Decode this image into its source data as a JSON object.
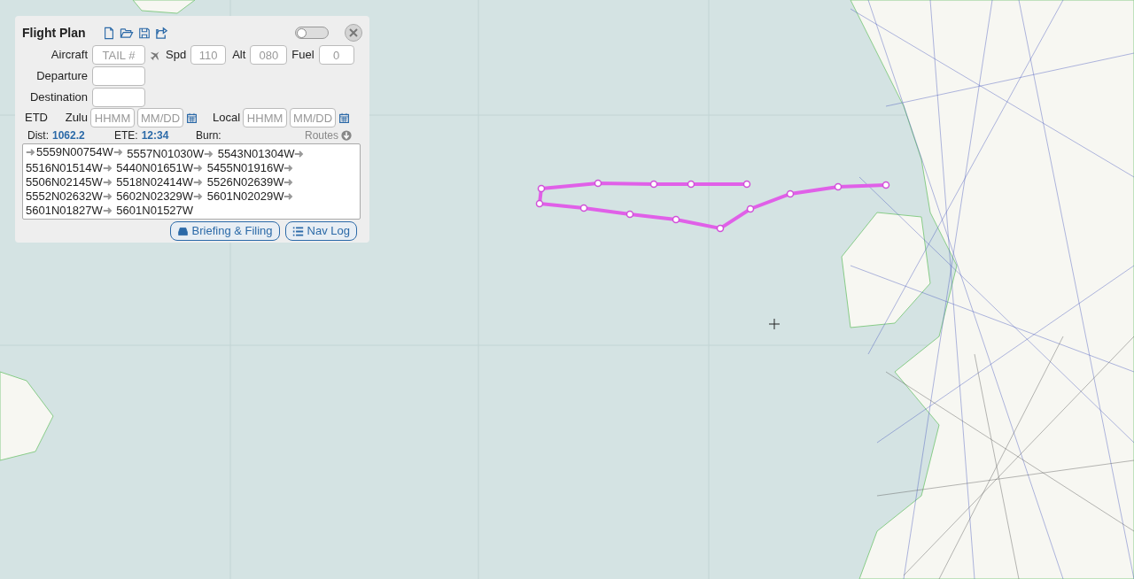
{
  "panel": {
    "title": "Flight Plan",
    "toggle": {
      "on": false
    }
  },
  "aircraft": {
    "label": "Aircraft",
    "placeholder": "TAIL #"
  },
  "speed": {
    "label": "Spd",
    "placeholder": "110"
  },
  "altitude": {
    "label": "Alt",
    "placeholder": "080"
  },
  "fuel": {
    "label": "Fuel",
    "placeholder": "0"
  },
  "departure": {
    "label": "Departure"
  },
  "destination": {
    "label": "Destination"
  },
  "etd": {
    "label": "ETD",
    "zulu": {
      "label": "Zulu",
      "time_placeholder": "HHMM",
      "date_placeholder": "MM/DD"
    },
    "local": {
      "label": "Local",
      "time_placeholder": "HHMM",
      "date_placeholder": "MM/DD"
    }
  },
  "stats": [
    {
      "label": "Dist:",
      "value": "1062.2"
    },
    {
      "label": "ETE:",
      "value": "12:34"
    },
    {
      "label": "Burn:"
    }
  ],
  "routes_link": "Routes",
  "waypoints": [
    "5559N00754W",
    "5557N01030W",
    "5543N01304W",
    "5516N01514W",
    "5440N01651W",
    "5455N01916W",
    "5506N02145W",
    "5518N02414W",
    "5526N02639W",
    "5552N02632W",
    "5602N02329W",
    "5601N02029W",
    "5601N01827W",
    "5601N01527W"
  ],
  "buttons": [
    {
      "kind": "briefing",
      "label": "Briefing & Filing"
    },
    {
      "kind": "navlog",
      "label": "Nav Log"
    }
  ]
}
